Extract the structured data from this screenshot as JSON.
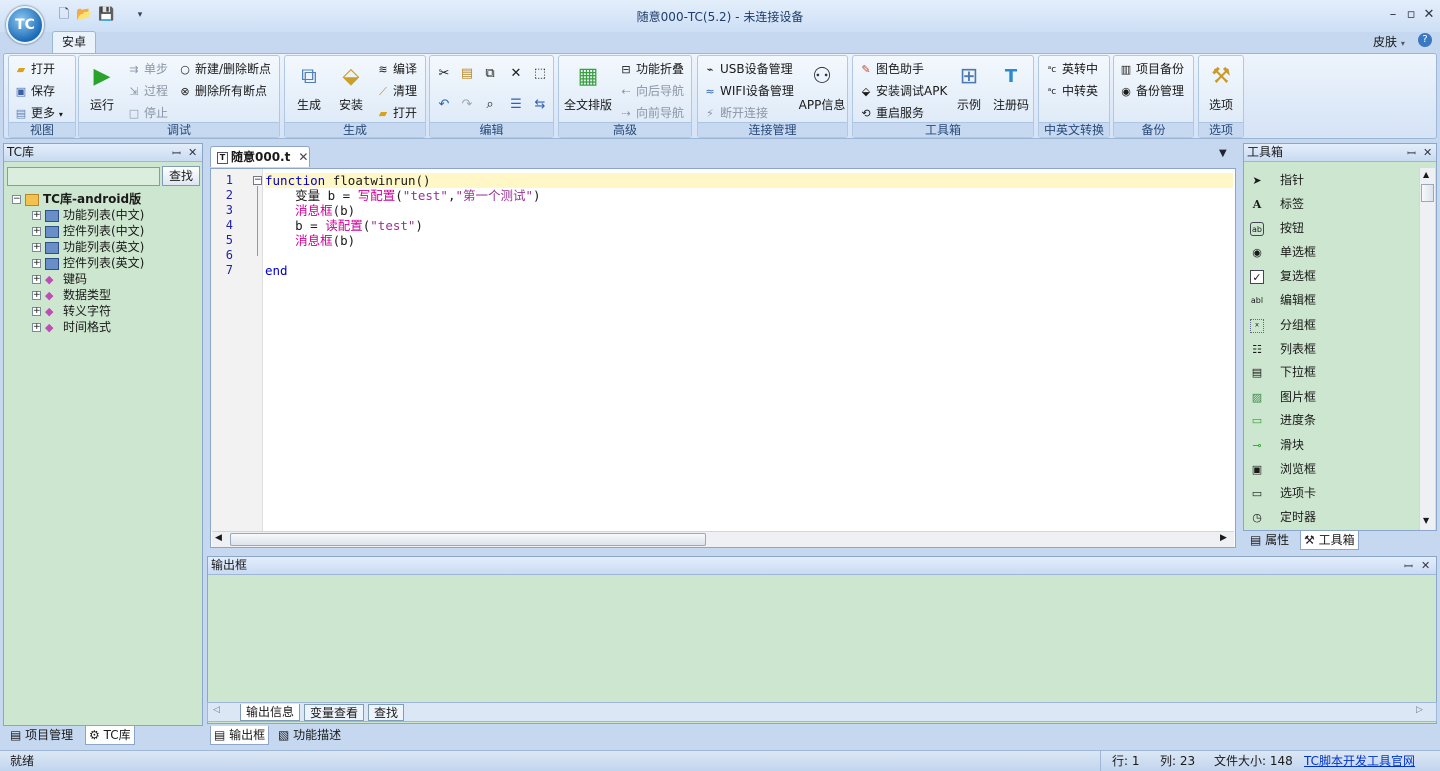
{
  "app": {
    "logo_text": "TC",
    "title": "随意000-TC(5.2) - 未连接设备",
    "ribbon_tab": "安卓",
    "skin_label": "皮肤",
    "help_icon": "?"
  },
  "ribbon": {
    "view": {
      "label": "视图",
      "open": "打开",
      "save": "保存",
      "more": "更多"
    },
    "debug": {
      "label": "调试",
      "run": "运行",
      "step": "单步",
      "process": "过程",
      "stop": "停止",
      "new_bp": "新建/删除断点",
      "del_bp": "删除所有断点"
    },
    "build": {
      "label": "生成",
      "build": "生成",
      "install": "安装",
      "compile": "编译",
      "clean": "清理",
      "open": "打开"
    },
    "edit": {
      "label": "编辑"
    },
    "advanced": {
      "label": "高级",
      "format": "全文排版",
      "fold": "功能折叠",
      "nav_back": "向后导航",
      "nav_fwd": "向前导航"
    },
    "conn": {
      "label": "连接管理",
      "usb": "USB设备管理",
      "wifi": "WIFI设备管理",
      "disconnect": "断开连接",
      "app_info": "APP信息"
    },
    "tools": {
      "label": "工具箱",
      "color": "图色助手",
      "install_apk": "安装调试APK",
      "restart": "重启服务",
      "example": "示例",
      "register": "注册码"
    },
    "cn_en": {
      "label": "中英文转换",
      "en_cn": "英转中",
      "cn_en": "中转英"
    },
    "backup": {
      "label": "备份",
      "proj_backup": "项目备份",
      "backup_mgr": "备份管理"
    },
    "options": {
      "label": "选项",
      "options": "选项"
    }
  },
  "left_panel": {
    "title": "TC库",
    "search_button": "查找",
    "search_value": "",
    "tree_root": "TC库-android版",
    "tree_items": [
      "功能列表(中文)",
      "控件列表(中文)",
      "功能列表(英文)",
      "控件列表(英文)",
      "键码",
      "数据类型",
      "转义字符",
      "时间格式"
    ],
    "bottom_tabs": [
      "项目管理",
      "TC库"
    ]
  },
  "editor": {
    "tab_label": "随意000.t",
    "line_numbers": [
      "1",
      "2",
      "3",
      "4",
      "5",
      "6",
      "7"
    ],
    "line1": {
      "kw": "function",
      "rest": " floatwinrun()"
    },
    "line2": {
      "indent": "    ",
      "a": "变量 b = ",
      "fn": "写配置",
      "p1": "(",
      "s1": "\"test\"",
      "comma": ",",
      "s2": "\"第一个测试\"",
      "p2": ")"
    },
    "line3": {
      "indent": "    ",
      "fn": "消息框",
      "rest": "(b)"
    },
    "line4": {
      "indent": "    ",
      "a": "b = ",
      "fn": "读配置",
      "p1": "(",
      "s1": "\"test\"",
      "p2": ")"
    },
    "line5": {
      "indent": "    ",
      "fn": "消息框",
      "rest": "(b)"
    },
    "line7": "end"
  },
  "output": {
    "title": "输出框",
    "tabs": [
      "输出信息",
      "变量查看",
      "查找"
    ],
    "bottom_tabs": [
      "输出框",
      "功能描述"
    ]
  },
  "toolbox": {
    "title": "工具箱",
    "items": [
      "指针",
      "标签",
      "按钮",
      "单选框",
      "复选框",
      "编辑框",
      "分组框",
      "列表框",
      "下拉框",
      "图片框",
      "进度条",
      "滑块",
      "浏览框",
      "选项卡",
      "定时器"
    ],
    "bottom_tabs": [
      "属性",
      "工具箱"
    ]
  },
  "status": {
    "ready": "就绪",
    "row": "行: 1",
    "col": "列: 23",
    "filesize": "文件大小: 148",
    "link": "TC脚本开发工具官网"
  },
  "colors": {
    "keyword": "#0000cc",
    "function": "#cc0099",
    "string": "#993399",
    "link": "#0033cc"
  }
}
